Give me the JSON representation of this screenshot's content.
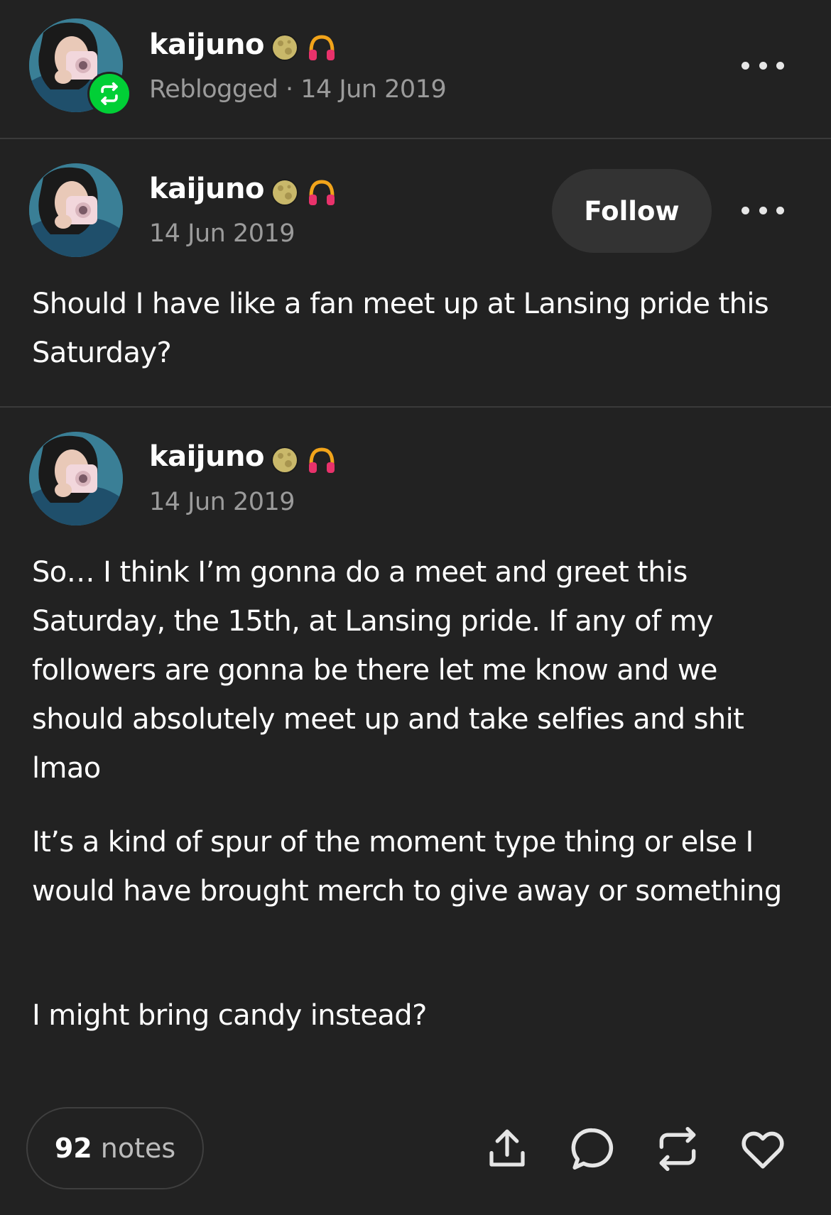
{
  "colors": {
    "background": "#222222",
    "text": "#ffffff",
    "muted": "#9b9b9b",
    "reblog_green": "#01cf36",
    "follow_bg": "#333333"
  },
  "reblog_header": {
    "username": "kaijuno",
    "meta": "Reblogged · 14 Jun 2019",
    "badges": [
      "moon-badge",
      "headphones-badge"
    ]
  },
  "post1": {
    "username": "kaijuno",
    "date": "14 Jun 2019",
    "follow_label": "Follow",
    "body": "Should I have like a fan meet up at Lansing pride this Saturday?"
  },
  "post2": {
    "username": "kaijuno",
    "date": "14 Jun 2019",
    "paragraphs": [
      "So… I think I’m gonna do a meet and greet this Saturday, the 15th, at Lansing pride. If any of my followers are gonna be there let me know and we should absolutely meet up and take selfies and shit lmao",
      "It’s a kind of spur of the moment type thing or else I would have brought merch to give away or something",
      "I might bring candy instead?"
    ]
  },
  "footer": {
    "notes_count": "92",
    "notes_label": "notes",
    "actions": [
      "share-icon",
      "comment-icon",
      "reblog-icon",
      "like-heart-icon"
    ]
  }
}
